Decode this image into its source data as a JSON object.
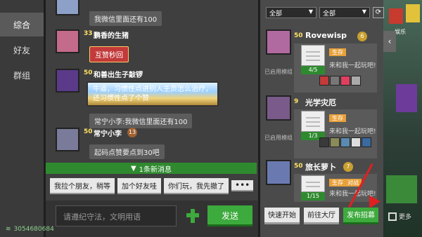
{
  "tabs": [
    {
      "label": "综合",
      "active": true
    },
    {
      "label": "好友",
      "active": false
    },
    {
      "label": "群组",
      "active": false
    }
  ],
  "chat": {
    "messages": [
      {
        "user": "",
        "level": "",
        "text": "我微信里面还有100",
        "style": "normal"
      },
      {
        "user": "鹏香的生猪",
        "level": "33",
        "text": "互赞秒回",
        "style": "red"
      },
      {
        "user": "和善出生子敲锣",
        "level": "50",
        "text": "牛逼，习惯性点进别人主页怎么治疗，还习惯性点了个赞",
        "style": "gold"
      },
      {
        "user": "",
        "level": "",
        "text": "常宁小李:我微信里面还有100",
        "style": "normal"
      },
      {
        "user": "常宁小李",
        "level": "50",
        "rank": "13",
        "text": "起码点赞要点到30吧",
        "style": "normal"
      }
    ],
    "new_message_label": "1条新消息",
    "faded_user": "常宁小李",
    "quick_replies": [
      "我拉个朋友，稍等",
      "加个好友哇",
      "你们玩，我先撤了"
    ],
    "more_label": "•••",
    "input_placeholder": "请遵纪守法，文明用语",
    "send_label": "发送",
    "net_id": "3054680684"
  },
  "panel": {
    "filter1": "全部",
    "filter2": "全部",
    "cards": [
      {
        "level": "50",
        "name": "Rovewisp",
        "rank": "6",
        "tag": "生存",
        "tag2": "",
        "slogan": "来和我一起玩吧!",
        "progress": "4/5",
        "used_label": "已启用模组"
      },
      {
        "level": "9",
        "name": "光学灾厄",
        "rank": "",
        "tag": "生存",
        "tag2": "",
        "slogan": "来和我一起玩吧!",
        "progress": "1/3",
        "used_label": "已启用模组"
      },
      {
        "level": "50",
        "name": "旅长萝卜",
        "rank": "7",
        "tag": "生存",
        "tag2": "对战",
        "slogan": "来和我一起玩吧!",
        "progress": "1/15",
        "used_label": ""
      }
    ],
    "actions": {
      "quick_start": "快速开始",
      "go_lobby": "前往大厅",
      "post_recruit": "发布招募"
    }
  },
  "background": {
    "more_label": "更多",
    "top_label": "娱乐"
  },
  "colors": {
    "accent_green": "#3daa3d",
    "red_arrow": "#e02020"
  }
}
